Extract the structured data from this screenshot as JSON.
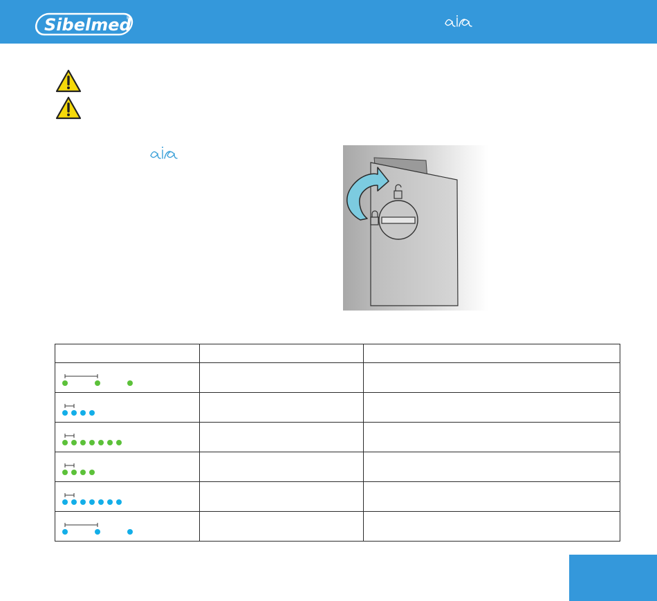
{
  "header": {
    "brand_logo": "Sibelmed",
    "product_logo": "aira",
    "background_color": "#3498db"
  },
  "warnings": [
    {
      "icon": "warning-triangle-icon"
    },
    {
      "icon": "warning-triangle-icon"
    }
  ],
  "body": {
    "product_logo": "aira",
    "figure": {
      "icons": [
        "rotate-arrow-icon",
        "unlock-icon",
        "lock-icon"
      ]
    }
  },
  "led_table": {
    "columns": [
      "",
      "",
      ""
    ],
    "rows": [
      {
        "pattern": {
          "color": "#5cc13a",
          "blinks": 3,
          "interval": "long"
        },
        "cells": [
          "",
          ""
        ]
      },
      {
        "pattern": {
          "color": "#13aee8",
          "blinks": 4,
          "interval": "short"
        },
        "cells": [
          "",
          ""
        ]
      },
      {
        "pattern": {
          "color": "#5cc13a",
          "blinks": 7,
          "interval": "short"
        },
        "cells": [
          "",
          ""
        ]
      },
      {
        "pattern": {
          "color": "#5cc13a",
          "blinks": 4,
          "interval": "short"
        },
        "cells": [
          "",
          ""
        ]
      },
      {
        "pattern": {
          "color": "#13aee8",
          "blinks": 7,
          "interval": "short"
        },
        "cells": [
          "",
          ""
        ]
      },
      {
        "pattern": {
          "color": "#13aee8",
          "blinks": 3,
          "interval": "long"
        },
        "cells": [
          "",
          ""
        ]
      }
    ]
  },
  "colors": {
    "accent": "#3498db",
    "led_green": "#5cc13a",
    "led_blue": "#13aee8",
    "warning_yellow": "#f5d90a"
  }
}
